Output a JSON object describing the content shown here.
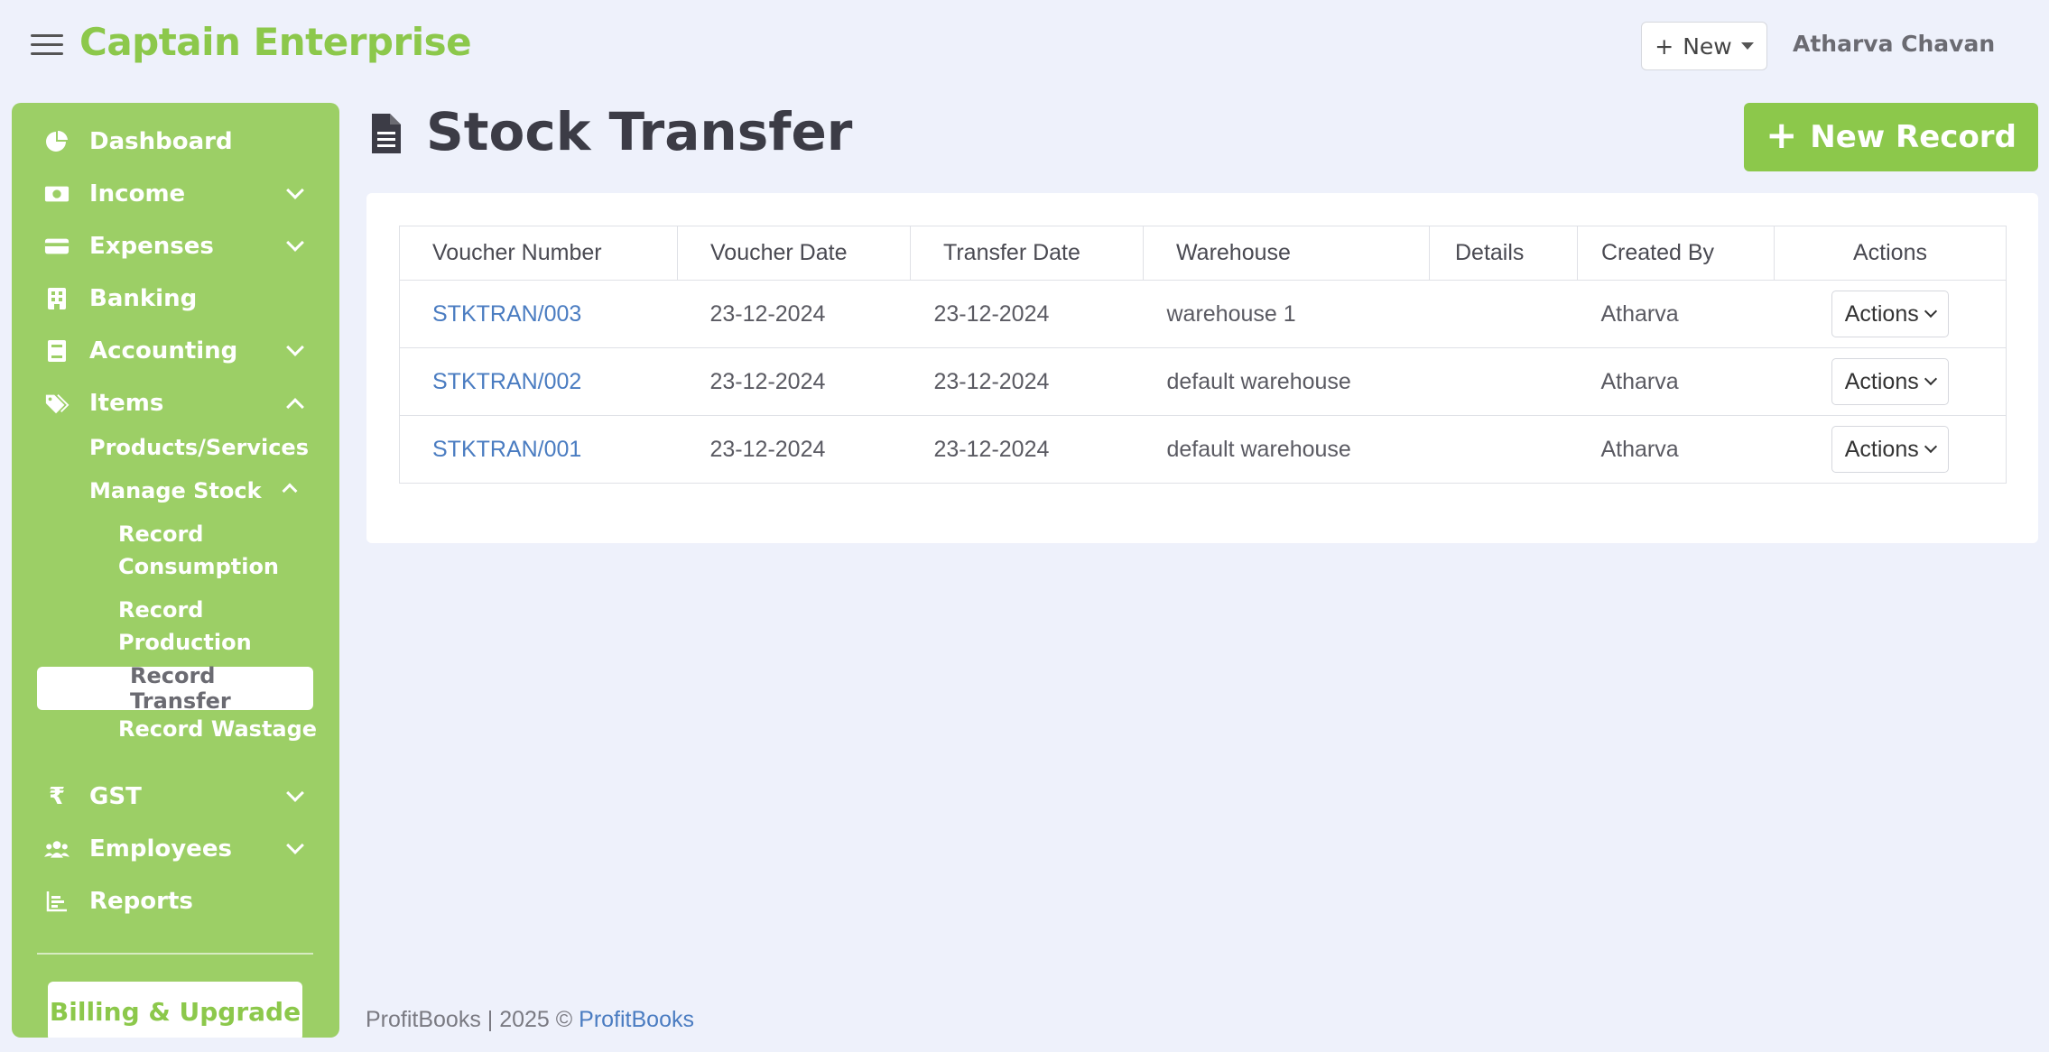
{
  "app": {
    "brand": "Captain Enterprise"
  },
  "topbar": {
    "new_label": "New",
    "user_name": "Atharva Chavan"
  },
  "sidebar": {
    "items": [
      {
        "label": "Dashboard",
        "icon": "pie-chart-icon"
      },
      {
        "label": "Income",
        "icon": "money-icon"
      },
      {
        "label": "Expenses",
        "icon": "card-icon"
      },
      {
        "label": "Banking",
        "icon": "bank-icon"
      },
      {
        "label": "Accounting",
        "icon": "ledger-icon"
      },
      {
        "label": "Items",
        "icon": "tag-icon"
      },
      {
        "label": "GST",
        "icon": "rupee-icon"
      },
      {
        "label": "Employees",
        "icon": "users-icon"
      },
      {
        "label": "Reports",
        "icon": "bar-chart-icon"
      }
    ],
    "items_sub": {
      "products": "Products/Services",
      "manage_stock": "Manage Stock"
    },
    "manage_stock_sub": {
      "consumption_1": "Record",
      "consumption_2": "Consumption",
      "production_1": "Record",
      "production_2": "Production",
      "transfer": "Record Transfer",
      "wastage": "Record Wastage"
    },
    "billing": "Billing & Upgrade"
  },
  "page": {
    "title": "Stock Transfer",
    "new_record": "New Record"
  },
  "table": {
    "headers": [
      "Voucher Number",
      "Voucher Date",
      "Transfer Date",
      "Warehouse",
      "Details",
      "Created By",
      "Actions"
    ],
    "rows": [
      {
        "voucher": "STKTRAN/003",
        "voucher_date": "23-12-2024",
        "transfer_date": "23-12-2024",
        "warehouse": "warehouse 1",
        "details": "",
        "created_by": "Atharva",
        "action": "Actions"
      },
      {
        "voucher": "STKTRAN/002",
        "voucher_date": "23-12-2024",
        "transfer_date": "23-12-2024",
        "warehouse": "default warehouse",
        "details": "",
        "created_by": "Atharva",
        "action": "Actions"
      },
      {
        "voucher": "STKTRAN/001",
        "voucher_date": "23-12-2024",
        "transfer_date": "23-12-2024",
        "warehouse": "default warehouse",
        "details": "",
        "created_by": "Atharva",
        "action": "Actions"
      }
    ]
  },
  "footer": {
    "text": "ProfitBooks | 2025 ©",
    "link": "ProfitBooks"
  },
  "colors": {
    "brand_green": "#8cc84b",
    "sidebar_green": "#9ccf66",
    "link_blue": "#4a7cc1",
    "background": "#eef1fb"
  }
}
